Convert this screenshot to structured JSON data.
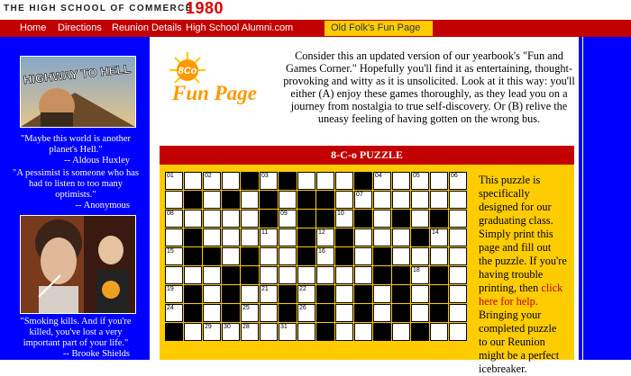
{
  "header": {
    "site_title": "THE HIGH SCHOOL OF COMMERCE",
    "site_year": "1980"
  },
  "nav": {
    "items": [
      "Home",
      "Directions",
      "Reunion Details",
      "High School Alumni.com"
    ],
    "active": "Old Folk's Fun Page"
  },
  "sidebar": {
    "promo1_title": "HIGHWAY TO HELL",
    "quotes": [
      {
        "text": "\"Maybe this world is another planet's Hell.\"",
        "attr": "-- Aldous Huxley"
      },
      {
        "text": "\"A pessimist is someone who has had to listen to too many optimists.\"",
        "attr": "-- Anonymous"
      },
      {
        "text": "\"Smoking kills. And if you're killed, you've lost a very important part of your life.\"",
        "attr": "-- Brooke Shields"
      }
    ]
  },
  "logo": {
    "badge": "8Co",
    "text": "Fun Page"
  },
  "intro": "Consider this an updated version of our yearbook's \"Fun and Games Corner.\" Hopefully you'll find it as entertaining, thought-provoking and witty as it is unsolicited. Look at it this way: you'll either (A) enjoy these games thoroughly, as they lead you on a journey from nostalgia to true self-discovery. Or (B) relive the uneasy feeling of having gotten on the wrong bus.",
  "puzzle": {
    "title": "8-C-o PUZZLE",
    "desc_before": "This puzzle is specifically designed for our graduating class. Simply print this page and fill out the puzzle. If you're having trouble printing, then ",
    "desc_link": "click here for help.",
    "desc_after": " Bringing your completed puzzle to our Reunion might be a perfect icebreaker.",
    "grid": [
      "....#.#...#.....",
      ".#.#.#.##.......",
      ".....#.##.#.#.#.",
      ".#.....#.#...#..",
      ".##.#..#.#.#....",
      "...##......##.#.",
      ".#.#..#.#.#.#.#.",
      ".#.#..#.#.#.#.#.",
      "#.......#..#.#.."
    ],
    "numbers": [
      {
        "r": 0,
        "c": 0,
        "n": "01"
      },
      {
        "r": 0,
        "c": 2,
        "n": "02"
      },
      {
        "r": 0,
        "c": 5,
        "n": "03"
      },
      {
        "r": 0,
        "c": 11,
        "n": "04"
      },
      {
        "r": 0,
        "c": 13,
        "n": "05"
      },
      {
        "r": 0,
        "c": 15,
        "n": "06"
      },
      {
        "r": 1,
        "c": 10,
        "n": "07"
      },
      {
        "r": 2,
        "c": 0,
        "n": "08"
      },
      {
        "r": 2,
        "c": 6,
        "n": "09"
      },
      {
        "r": 2,
        "c": 9,
        "n": "10"
      },
      {
        "r": 3,
        "c": 5,
        "n": "11"
      },
      {
        "r": 3,
        "c": 8,
        "n": "12"
      },
      {
        "r": 3,
        "c": 13,
        "n": "13"
      },
      {
        "r": 3,
        "c": 14,
        "n": "14"
      },
      {
        "r": 4,
        "c": 0,
        "n": "15"
      },
      {
        "r": 4,
        "c": 8,
        "n": "16"
      },
      {
        "r": 4,
        "c": 11,
        "n": "17"
      },
      {
        "r": 5,
        "c": 13,
        "n": "18"
      },
      {
        "r": 6,
        "c": 0,
        "n": "19"
      },
      {
        "r": 6,
        "c": 1,
        "n": "20"
      },
      {
        "r": 6,
        "c": 5,
        "n": "21"
      },
      {
        "r": 6,
        "c": 7,
        "n": "22"
      },
      {
        "r": 6,
        "c": 8,
        "n": "23"
      },
      {
        "r": 7,
        "c": 0,
        "n": "24"
      },
      {
        "r": 7,
        "c": 7,
        "n": "26"
      },
      {
        "r": 7,
        "c": 10,
        "n": "27"
      },
      {
        "r": 7,
        "c": 4,
        "n": "25"
      },
      {
        "r": 8,
        "c": 4,
        "n": "28"
      },
      {
        "r": 8,
        "c": 2,
        "n": "29"
      },
      {
        "r": 8,
        "c": 3,
        "n": "30"
      },
      {
        "r": 8,
        "c": 6,
        "n": "31"
      },
      {
        "r": 8,
        "c": 11,
        "n": "32"
      }
    ]
  },
  "colors": {
    "primary_blue": "#0000ff",
    "nav_red": "#c20000",
    "accent_yellow": "#ffcc00"
  }
}
